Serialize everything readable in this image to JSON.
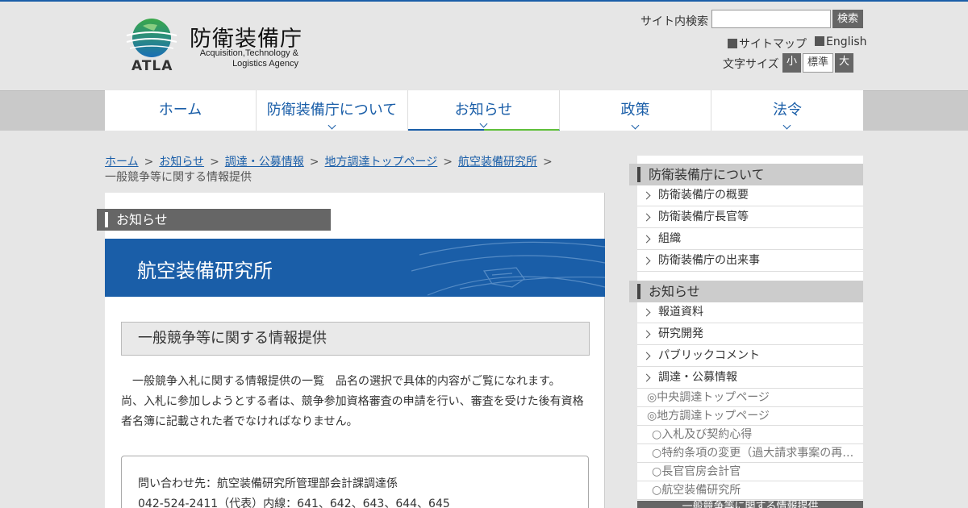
{
  "header": {
    "org_name": "防衛装備庁",
    "org_name_en": "Acquisition,Technology & Logistics Agency",
    "logo_text": "ATLA",
    "search_label": "サイト内検索",
    "search_button": "検索",
    "search_value": "",
    "sitemap_label": "サイトマップ",
    "english_label": "English",
    "fontsize_label": "文字サイズ",
    "fontsize_small": "小",
    "fontsize_standard": "標準",
    "fontsize_large": "大"
  },
  "nav": [
    {
      "label": "ホーム"
    },
    {
      "label": "防衛装備庁について"
    },
    {
      "label": "お知らせ"
    },
    {
      "label": "政策"
    },
    {
      "label": "法令"
    }
  ],
  "breadcrumb": {
    "items": [
      "ホーム",
      "お知らせ",
      "調達・公募情報",
      "地方調達トップページ",
      "航空装備研究所"
    ],
    "current": "一般競争等に関する情報提供",
    "separator": ">"
  },
  "main": {
    "category": "お知らせ",
    "banner_title": "航空装備研究所",
    "sub_title": "一般競争等に関する情報提供",
    "body_line1": "一般競争入札に関する情報提供の一覧　品名の選択で具体的内容がご覧になれます。",
    "body_line2": "尚、入札に参加しようとする者は、競争参加資格審査の申請を行い、審査を受けた後有資格",
    "body_line3": "者名簿に記載された者でなければなりません。",
    "contact_line1": "問い合わせ先：航空装備研究所管理部会計課調達係",
    "contact_line2": "042-524-2411（代表）内線：641、642、643、644、645"
  },
  "sidebar": {
    "section1_title": "防衛装備庁について",
    "section1_items": [
      "防衛装備庁の概要",
      "防衛装備庁長官等",
      "組織",
      "防衛装備庁の出来事"
    ],
    "section2_title": "お知らせ",
    "section2_items": [
      "報道資料",
      "研究開発",
      "パブリックコメント",
      "調達・公募情報"
    ],
    "sub_items": [
      "◎中央調達トップページ",
      "◎地方調達トップページ",
      "○入札及び契約心得",
      "○特約条項の変更（過大請求事案の再…",
      "○長官官房会計官",
      "○航空装備研究所"
    ],
    "current_item": "一般競争等に関する情報提供"
  },
  "colors": {
    "brand_blue": "#1a5ea8",
    "accent_green": "#5fbf3a",
    "dark_gray": "#666666"
  }
}
